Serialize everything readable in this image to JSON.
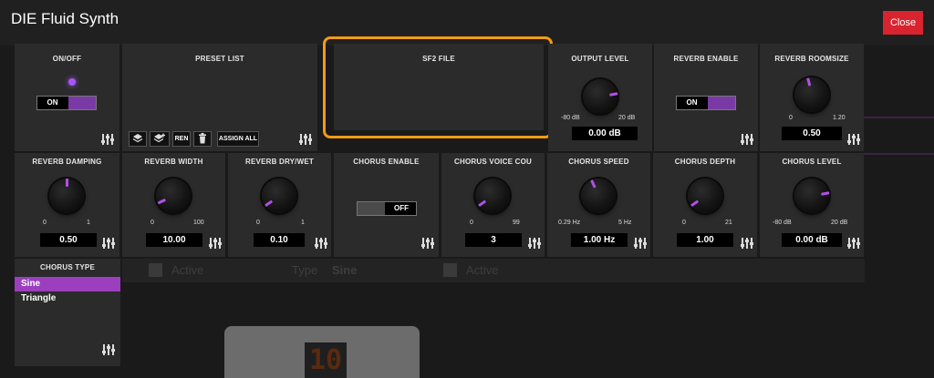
{
  "window": {
    "title": "DIE Fluid Synth",
    "close_label": "Close"
  },
  "background": {
    "active_1": "Active",
    "type_label": "Type",
    "type_value": "Sine",
    "active_2": "Active",
    "digit": "10"
  },
  "on_off": {
    "title": "ON/OFF",
    "toggle_label": "ON",
    "state": "on"
  },
  "preset_list": {
    "title": "PRESET LIST",
    "ren_label": "REN",
    "assign_all_label": "ASSIGN ALL"
  },
  "sf2_file": {
    "title": "SF2 FILE"
  },
  "output_level": {
    "title": "OUTPUT LEVEL",
    "min": "-80 dB",
    "max": "20 dB",
    "value": "0.00 dB"
  },
  "reverb_enable": {
    "title": "REVERB ENABLE",
    "toggle_label": "ON",
    "state": "on"
  },
  "reverb_roomsize": {
    "title": "REVERB ROOMSIZE",
    "min": "0",
    "max": "1.20",
    "value": "0.50"
  },
  "reverb_damping": {
    "title": "REVERB DAMPING",
    "min": "0",
    "max": "1",
    "value": "0.50"
  },
  "reverb_width": {
    "title": "REVERB WIDTH",
    "min": "0",
    "max": "100",
    "value": "10.00"
  },
  "reverb_drywet": {
    "title": "REVERB DRY/WET",
    "min": "0",
    "max": "1",
    "value": "0.10"
  },
  "chorus_enable": {
    "title": "CHORUS ENABLE",
    "toggle_label": "OFF",
    "state": "off"
  },
  "chorus_voice": {
    "title": "CHORUS VOICE COU",
    "min": "0",
    "max": "99",
    "value": "3"
  },
  "chorus_speed": {
    "title": "CHORUS SPEED",
    "min": "0.29 Hz",
    "max": "5 Hz",
    "value": "1.00 Hz"
  },
  "chorus_depth": {
    "title": "CHORUS DEPTH",
    "min": "0",
    "max": "21",
    "value": "1.00"
  },
  "chorus_level": {
    "title": "CHORUS LEVEL",
    "min": "-80 dB",
    "max": "20 dB",
    "value": "0.00 dB"
  },
  "chorus_type": {
    "title": "CHORUS TYPE",
    "options": [
      "Sine",
      "Triangle"
    ],
    "selected": "Sine"
  },
  "colors": {
    "accent": "#9b3fbe",
    "close": "#d8242e",
    "highlight": "#f29a16",
    "panel": "#2b2b2b"
  }
}
